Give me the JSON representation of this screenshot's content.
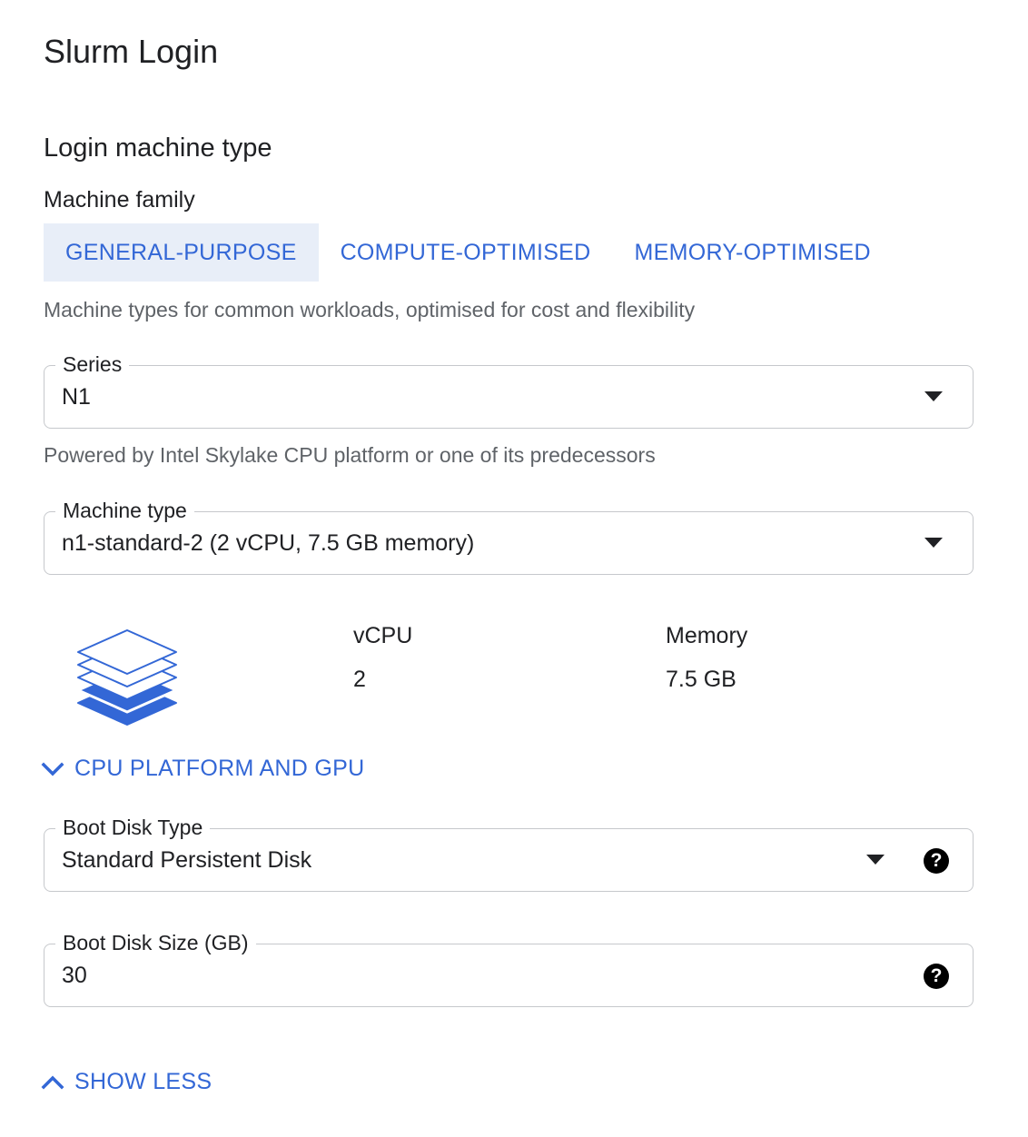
{
  "page": {
    "title": "Slurm Login"
  },
  "login_machine": {
    "section_title": "Login machine type",
    "family_label": "Machine family",
    "tabs": [
      {
        "label": "GENERAL-PURPOSE",
        "active": true
      },
      {
        "label": "COMPUTE-OPTIMISED",
        "active": false
      },
      {
        "label": "MEMORY-OPTIMISED",
        "active": false
      }
    ],
    "family_description": "Machine types for common workloads, optimised for cost and flexibility",
    "series": {
      "label": "Series",
      "value": "N1",
      "helper": "Powered by Intel Skylake CPU platform or one of its predecessors"
    },
    "machine_type": {
      "label": "Machine type",
      "value": "n1-standard-2 (2 vCPU, 7.5 GB memory)"
    },
    "specs": {
      "icon": "layers-icon",
      "vcpu_label": "vCPU",
      "vcpu_value": "2",
      "memory_label": "Memory",
      "memory_value": "7.5 GB"
    },
    "cpu_platform_toggle": {
      "label": "CPU PLATFORM AND GPU",
      "icon": "chevron-down-icon"
    },
    "boot_disk_type": {
      "label": "Boot Disk Type",
      "value": "Standard Persistent Disk"
    },
    "boot_disk_size": {
      "label": "Boot Disk Size (GB)",
      "value": "30"
    },
    "show_less": {
      "label": "SHOW LESS",
      "icon": "chevron-up-icon"
    }
  },
  "colors": {
    "accent": "#3367d6",
    "active_tab_bg": "#e8eef8",
    "border": "#c6c8cc",
    "helper_text": "#5f6368"
  }
}
